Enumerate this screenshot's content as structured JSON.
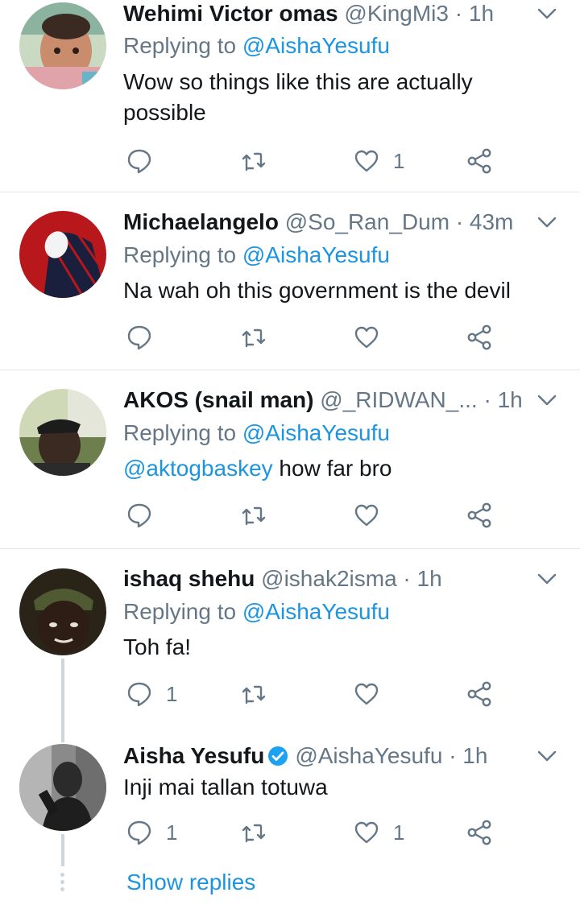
{
  "tweets": [
    {
      "name": "Wehimi Victor omas",
      "handle": "@KingMi3",
      "time": "· 1h",
      "replying_prefix": "Replying to",
      "replying_to": "@AishaYesufu",
      "text_line1": "Wow so things like this are actually",
      "text_line2": "possible",
      "reply_count": "",
      "retweet_count": "",
      "like_count": "1"
    },
    {
      "name": "Michaelangelo",
      "handle": "@So_Ran_Dum",
      "time": "· 43m",
      "replying_prefix": "Replying to",
      "replying_to": "@AishaYesufu",
      "text": "Na wah oh this government is the devil",
      "reply_count": "",
      "retweet_count": "",
      "like_count": ""
    },
    {
      "name": "AKOS (snail man)",
      "handle": "@_RIDWAN_...",
      "time": "· 1h",
      "replying_prefix": "Replying to",
      "replying_to": "@AishaYesufu",
      "text_mention": "@aktogbaskey",
      "text": " how far bro",
      "reply_count": "",
      "retweet_count": "",
      "like_count": ""
    },
    {
      "name": "ishaq shehu",
      "handle": "@ishak2isma",
      "time": "· 1h",
      "replying_prefix": "Replying to",
      "replying_to": "@AishaYesufu",
      "text": "Toh fa!",
      "reply_count": "1",
      "retweet_count": "",
      "like_count": ""
    },
    {
      "name": "Aisha Yesufu",
      "verified": true,
      "handle": "@AishaYesufu",
      "time": "· 1h",
      "text": "Inji mai tallan totuwa",
      "reply_count": "1",
      "retweet_count": "",
      "like_count": "1"
    }
  ],
  "show_replies_label": "Show replies",
  "icons": {
    "reply": "reply-icon",
    "retweet": "retweet-icon",
    "like": "heart-icon",
    "share": "share-icon",
    "more": "chevron-down-icon",
    "verified": "verified-badge-icon"
  },
  "colors": {
    "link": "#1b95e0",
    "secondary": "#657786",
    "icon": "#657786",
    "divider": "#e1e8ed",
    "verified": "#1da1f2"
  }
}
